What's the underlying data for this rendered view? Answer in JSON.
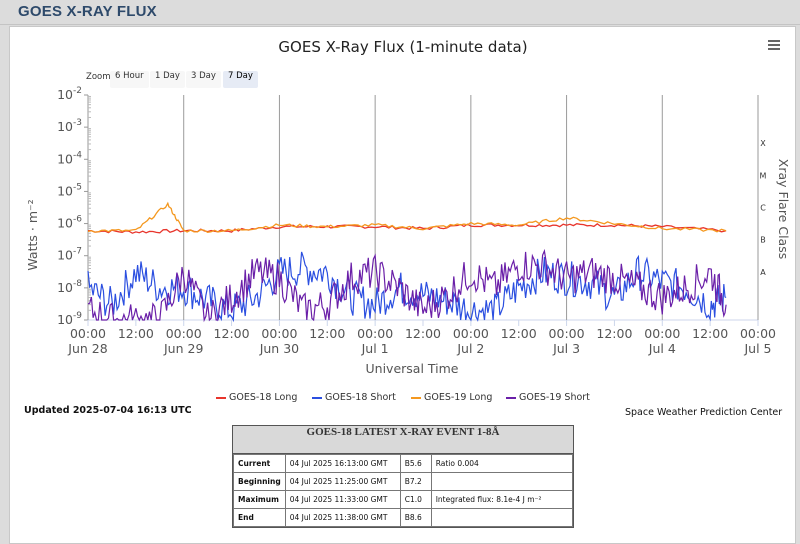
{
  "page": {
    "header_title": "GOES X-RAY FLUX"
  },
  "chart_data": {
    "type": "line",
    "title": "GOES X-Ray Flux (1-minute data)",
    "xlabel": "Universal Time",
    "ylabel": "Watts · m⁻²",
    "y2label": "Xray Flare Class",
    "yscale": "log",
    "ylim": [
      1e-09,
      0.01
    ],
    "y_ticks": [
      {
        "base": "10",
        "exp": "-2"
      },
      {
        "base": "10",
        "exp": "-3"
      },
      {
        "base": "10",
        "exp": "-4"
      },
      {
        "base": "10",
        "exp": "-5"
      },
      {
        "base": "10",
        "exp": "-6"
      },
      {
        "base": "10",
        "exp": "-7"
      },
      {
        "base": "10",
        "exp": "-8"
      },
      {
        "base": "10",
        "exp": "-9"
      }
    ],
    "flare_classes": [
      {
        "label": "X",
        "level": 0.0001
      },
      {
        "label": "M",
        "level": 1e-05
      },
      {
        "label": "C",
        "level": 1e-06
      },
      {
        "label": "B",
        "level": 1e-07
      },
      {
        "label": "A",
        "level": 1e-08
      }
    ],
    "xlim": [
      "2025-06-28 00:00",
      "2025-07-05 00:00"
    ],
    "x_ticks": [
      {
        "at": "2025-06-28 00:00",
        "time": "00:00",
        "date": "Jun 28"
      },
      {
        "at": "2025-06-28 12:00",
        "time": "12:00",
        "date": ""
      },
      {
        "at": "2025-06-29 00:00",
        "time": "00:00",
        "date": "Jun 29"
      },
      {
        "at": "2025-06-29 12:00",
        "time": "12:00",
        "date": ""
      },
      {
        "at": "2025-06-30 00:00",
        "time": "00:00",
        "date": "Jun 30"
      },
      {
        "at": "2025-06-30 12:00",
        "time": "12:00",
        "date": ""
      },
      {
        "at": "2025-07-01 00:00",
        "time": "00:00",
        "date": "Jul 1"
      },
      {
        "at": "2025-07-01 12:00",
        "time": "12:00",
        "date": ""
      },
      {
        "at": "2025-07-02 00:00",
        "time": "00:00",
        "date": "Jul 2"
      },
      {
        "at": "2025-07-02 12:00",
        "time": "12:00",
        "date": ""
      },
      {
        "at": "2025-07-03 00:00",
        "time": "00:00",
        "date": "Jul 3"
      },
      {
        "at": "2025-07-03 12:00",
        "time": "12:00",
        "date": ""
      },
      {
        "at": "2025-07-04 00:00",
        "time": "00:00",
        "date": "Jul 4"
      },
      {
        "at": "2025-07-04 12:00",
        "time": "12:00",
        "date": ""
      },
      {
        "at": "2025-07-05 00:00",
        "time": "00:00",
        "date": "Jul 5"
      }
    ],
    "grid": "vertical lines at 00:00",
    "legend_position": "bottom",
    "series": [
      {
        "name": "GOES-18 Long",
        "color": "#e8352c",
        "x": [
          "2025-06-28 00:00",
          "2025-06-28 12:00",
          "2025-06-29 00:00",
          "2025-06-29 12:00",
          "2025-06-30 00:00",
          "2025-06-30 12:00",
          "2025-07-01 00:00",
          "2025-07-01 12:00",
          "2025-07-02 00:00",
          "2025-07-02 12:00",
          "2025-07-03 00:00",
          "2025-07-03 12:00",
          "2025-07-04 00:00",
          "2025-07-04 16:00"
        ],
        "y": [
          6e-07,
          5.5e-07,
          6e-07,
          6e-07,
          8e-07,
          8e-07,
          8e-07,
          7e-07,
          9e-07,
          9e-07,
          9e-07,
          9e-07,
          8e-07,
          6e-07
        ]
      },
      {
        "name": "GOES-18 Short",
        "color": "#2b4fe0",
        "x": [
          "2025-06-28 00:00",
          "2025-06-28 06:00",
          "2025-06-28 12:00",
          "2025-06-28 18:00",
          "2025-06-29 00:00",
          "2025-06-29 06:00",
          "2025-06-29 12:00",
          "2025-06-29 18:00",
          "2025-06-30 00:00",
          "2025-06-30 06:00",
          "2025-06-30 12:00",
          "2025-06-30 18:00",
          "2025-07-01 00:00",
          "2025-07-01 06:00",
          "2025-07-01 12:00",
          "2025-07-01 18:00",
          "2025-07-02 00:00",
          "2025-07-02 06:00",
          "2025-07-02 12:00",
          "2025-07-02 18:00",
          "2025-07-03 00:00",
          "2025-07-03 06:00",
          "2025-07-03 12:00",
          "2025-07-03 18:00",
          "2025-07-04 00:00",
          "2025-07-04 06:00",
          "2025-07-04 12:00",
          "2025-07-04 16:00"
        ],
        "y": [
          1e-08,
          3e-09,
          3e-08,
          1e-08,
          1e-08,
          4e-09,
          2e-09,
          5e-09,
          3e-08,
          4e-08,
          3e-08,
          5e-09,
          3e-09,
          1e-08,
          6e-09,
          4e-09,
          2e-09,
          2e-09,
          1e-08,
          3e-08,
          2e-08,
          1.5e-08,
          5e-09,
          3e-08,
          1.5e-08,
          1e-08,
          3e-09,
          5e-09
        ]
      },
      {
        "name": "GOES-19 Long",
        "color": "#f4981f",
        "x": [
          "2025-06-28 00:00",
          "2025-06-28 12:00",
          "2025-06-28 20:00",
          "2025-06-29 00:00",
          "2025-06-29 12:00",
          "2025-06-30 00:00",
          "2025-06-30 12:00",
          "2025-07-01 00:00",
          "2025-07-01 12:00",
          "2025-07-02 00:00",
          "2025-07-02 12:00",
          "2025-07-03 00:00",
          "2025-07-03 12:00",
          "2025-07-04 00:00",
          "2025-07-04 16:00"
        ],
        "y": [
          6e-07,
          6e-07,
          4e-06,
          6e-07,
          6e-07,
          9e-07,
          8e-07,
          9e-07,
          7e-07,
          1e-06,
          9e-07,
          1.5e-06,
          1e-06,
          7e-07,
          6e-07
        ]
      },
      {
        "name": "GOES-19 Short",
        "color": "#6a1fa8",
        "x": [
          "2025-06-28 00:00",
          "2025-06-28 06:00",
          "2025-06-28 12:00",
          "2025-06-28 18:00",
          "2025-06-29 00:00",
          "2025-06-29 06:00",
          "2025-06-29 12:00",
          "2025-06-29 18:00",
          "2025-06-30 00:00",
          "2025-06-30 06:00",
          "2025-06-30 12:00",
          "2025-06-30 18:00",
          "2025-07-01 00:00",
          "2025-07-01 06:00",
          "2025-07-01 12:00",
          "2025-07-01 18:00",
          "2025-07-02 00:00",
          "2025-07-02 06:00",
          "2025-07-02 12:00",
          "2025-07-02 18:00",
          "2025-07-03 00:00",
          "2025-07-03 06:00",
          "2025-07-03 12:00",
          "2025-07-03 18:00",
          "2025-07-04 00:00",
          "2025-07-04 06:00",
          "2025-07-04 12:00",
          "2025-07-04 16:00"
        ],
        "y": [
          2e-09,
          1e-09,
          1e-09,
          1e-09,
          3e-08,
          1e-09,
          5e-09,
          3e-08,
          2e-08,
          2e-09,
          3e-09,
          2e-08,
          3e-08,
          1e-08,
          2e-09,
          6e-09,
          3e-08,
          1e-08,
          5e-08,
          5e-08,
          2e-08,
          3e-08,
          2e-08,
          1e-08,
          5e-09,
          1e-08,
          3e-08,
          3e-09
        ]
      }
    ]
  },
  "zoom": {
    "label": "Zoom",
    "buttons": [
      "6 Hour",
      "1 Day",
      "3 Day",
      "7 Day"
    ],
    "selected": "7 Day"
  },
  "updated": "Updated 2025-07-04 16:13 UTC",
  "credit": "Space Weather Prediction Center",
  "event_table": {
    "title": "GOES-18 LATEST X-RAY EVENT 1-8Å",
    "rows": [
      {
        "key": "Current",
        "date": "04 Jul 2025 16:13:00 GMT",
        "cls": "B5.6",
        "note": "Ratio 0.004"
      },
      {
        "key": "Beginning",
        "date": "04 Jul 2025 11:25:00 GMT",
        "cls": "B7.2",
        "note": ""
      },
      {
        "key": "Maximum",
        "date": "04 Jul 2025 11:33:00 GMT",
        "cls": "C1.0",
        "note": "Integrated flux: 8.1e-4 J m⁻²"
      },
      {
        "key": "End",
        "date": "04 Jul 2025 11:38:00 GMT",
        "cls": "B8.6",
        "note": ""
      }
    ]
  }
}
